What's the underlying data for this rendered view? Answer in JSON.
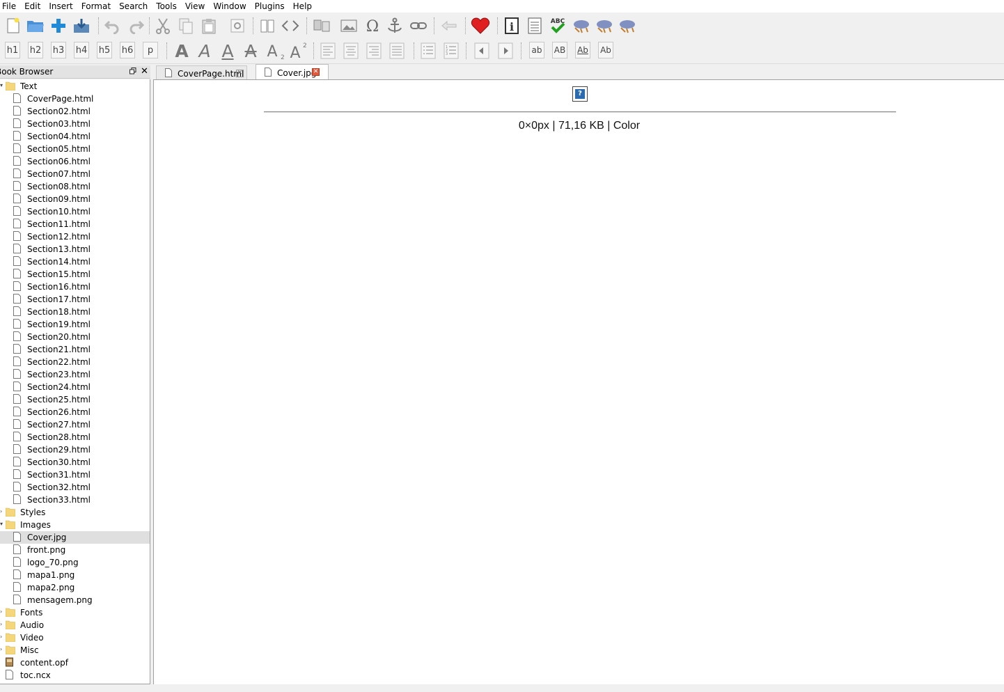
{
  "menu": [
    "File",
    "Edit",
    "Insert",
    "Format",
    "Search",
    "Tools",
    "View",
    "Window",
    "Plugins",
    "Help"
  ],
  "toolbar2": {
    "headings": [
      "h1",
      "h2",
      "h3",
      "h4",
      "h5",
      "h6",
      "p"
    ],
    "case_buttons": [
      "ab",
      "AB",
      "Ab",
      "Ab"
    ]
  },
  "book_browser": {
    "title": "Book Browser",
    "folders": {
      "text": "Text",
      "styles": "Styles",
      "images": "Images",
      "fonts": "Fonts",
      "audio": "Audio",
      "video": "Video",
      "misc": "Misc"
    },
    "text_files": [
      "CoverPage.html",
      "Section02.html",
      "Section03.html",
      "Section04.html",
      "Section05.html",
      "Section06.html",
      "Section07.html",
      "Section08.html",
      "Section09.html",
      "Section10.html",
      "Section11.html",
      "Section12.html",
      "Section13.html",
      "Section14.html",
      "Section15.html",
      "Section16.html",
      "Section17.html",
      "Section18.html",
      "Section19.html",
      "Section20.html",
      "Section21.html",
      "Section22.html",
      "Section23.html",
      "Section24.html",
      "Section25.html",
      "Section26.html",
      "Section27.html",
      "Section28.html",
      "Section29.html",
      "Section30.html",
      "Section31.html",
      "Section32.html",
      "Section33.html"
    ],
    "image_files": [
      "Cover.jpg",
      "front.png",
      "logo_70.png",
      "mapa1.png",
      "mapa2.png",
      "mensagem.png"
    ],
    "selected": "Cover.jpg",
    "root_files": [
      "content.opf",
      "toc.ncx"
    ]
  },
  "tabs": [
    {
      "label": "CoverPage.html",
      "active": false
    },
    {
      "label": "Cover.jpg",
      "active": true
    }
  ],
  "image_view": {
    "info": "0×0px | 71,16 KB | Color",
    "placeholder_glyph": "?"
  },
  "colors": {
    "close_active": "#e05a3c",
    "heart": "#e02020",
    "check": "#22a020",
    "folder": "#f5d67a",
    "plus": "#1f8ad8"
  }
}
